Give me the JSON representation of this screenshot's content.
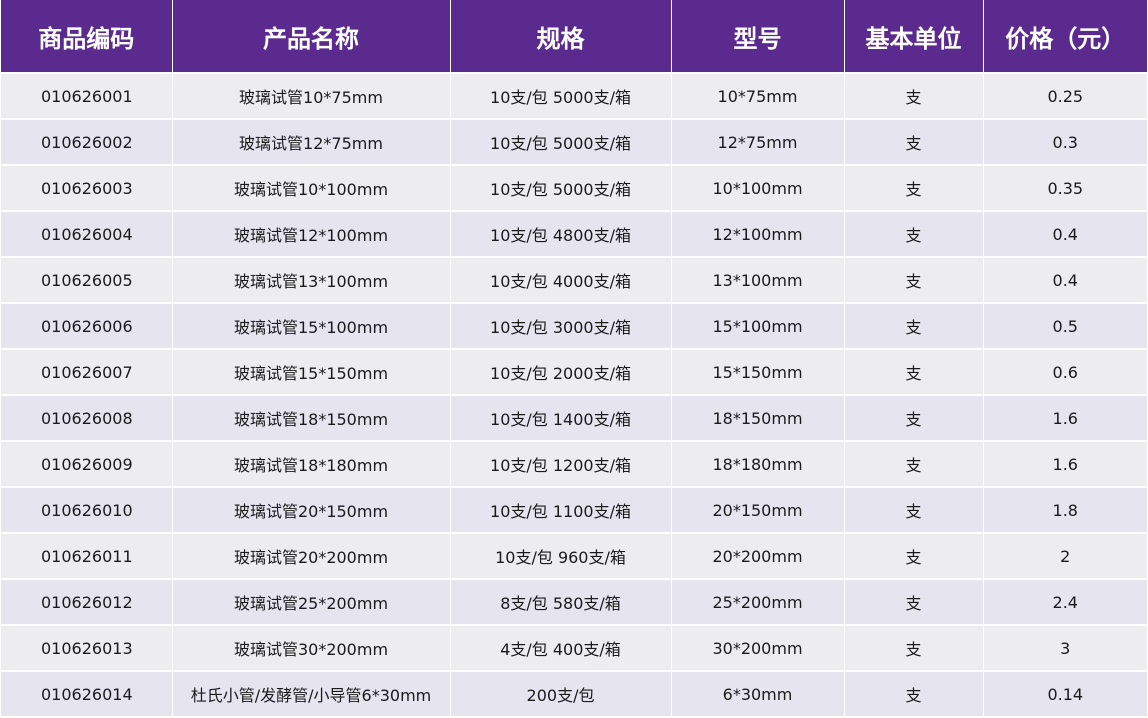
{
  "table": {
    "headers": [
      "商品编码",
      "产品名称",
      "规格",
      "型号",
      "基本单位",
      "价格（元）"
    ],
    "rows": [
      [
        "010626001",
        "玻璃试管10*75mm",
        "10支/包 5000支/箱",
        "10*75mm",
        "支",
        "0.25"
      ],
      [
        "010626002",
        "玻璃试管12*75mm",
        "10支/包 5000支/箱",
        "12*75mm",
        "支",
        "0.3"
      ],
      [
        "010626003",
        "玻璃试管10*100mm",
        "10支/包 5000支/箱",
        "10*100mm",
        "支",
        "0.35"
      ],
      [
        "010626004",
        "玻璃试管12*100mm",
        "10支/包 4800支/箱",
        "12*100mm",
        "支",
        "0.4"
      ],
      [
        "010626005",
        "玻璃试管13*100mm",
        "10支/包 4000支/箱",
        "13*100mm",
        "支",
        "0.4"
      ],
      [
        "010626006",
        "玻璃试管15*100mm",
        "10支/包 3000支/箱",
        "15*100mm",
        "支",
        "0.5"
      ],
      [
        "010626007",
        "玻璃试管15*150mm",
        "10支/包 2000支/箱",
        "15*150mm",
        "支",
        "0.6"
      ],
      [
        "010626008",
        "玻璃试管18*150mm",
        "10支/包 1400支/箱",
        "18*150mm",
        "支",
        "1.6"
      ],
      [
        "010626009",
        "玻璃试管18*180mm",
        "10支/包 1200支/箱",
        "18*180mm",
        "支",
        "1.6"
      ],
      [
        "010626010",
        "玻璃试管20*150mm",
        "10支/包 1100支/箱",
        "20*150mm",
        "支",
        "1.8"
      ],
      [
        "010626011",
        "玻璃试管20*200mm",
        "10支/包  960支/箱",
        "20*200mm",
        "支",
        "2"
      ],
      [
        "010626012",
        "玻璃试管25*200mm",
        "8支/包  580支/箱",
        "25*200mm",
        "支",
        "2.4"
      ],
      [
        "010626013",
        "玻璃试管30*200mm",
        "4支/包  400支/箱",
        "30*200mm",
        "支",
        "3"
      ],
      [
        "010626014",
        "杜氏小管/发酵管/小导管6*30mm",
        "200支/包",
        "6*30mm",
        "支",
        "0.14"
      ]
    ]
  },
  "colors": {
    "header_bg": "#5b2a8e",
    "header_text": "#ffffff",
    "row_odd_bg": "#ededf0",
    "row_even_bg": "#e6e4ef"
  }
}
